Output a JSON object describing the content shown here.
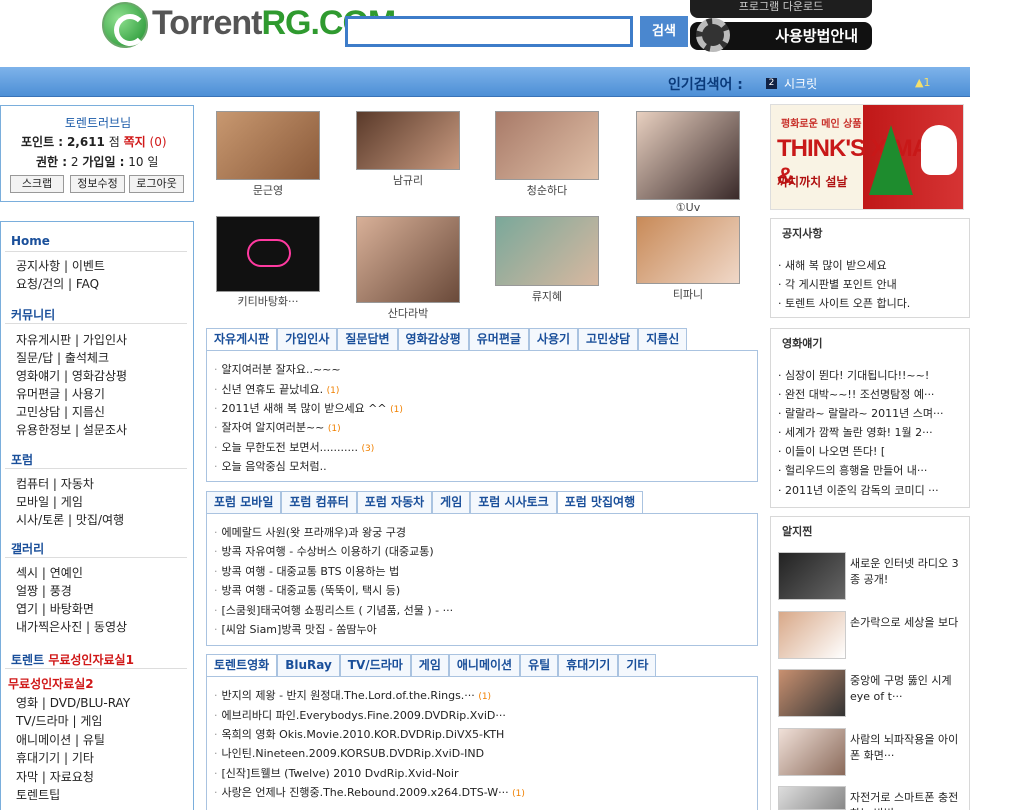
{
  "header": {
    "logo_prefix": "Torrent",
    "logo_suffix": "RG.COM",
    "search_value": "",
    "search_button": "검색",
    "program_download": "프로그램 다운로드",
    "guide": "사용방법안내"
  },
  "popular": {
    "label": "인기검색어 :",
    "rank_number": "2",
    "keyword": "시크릿",
    "rank_change": "▲1"
  },
  "user": {
    "name": "토렌트러브님",
    "points_label": "포인트 :",
    "points": "2,611",
    "points_unit": "점",
    "note_label": "쪽지",
    "note_count": "(0)",
    "rank_label": "권한 :",
    "rank_value": "2",
    "join_label": "가입일 :",
    "join_value": "10 일",
    "scrap": "스크랩",
    "edit": "정보수정",
    "logout": "로그아웃"
  },
  "sidebar": {
    "home": "Home",
    "home_items": [
      "공지사항 | 이벤트",
      "요청/건의 | FAQ"
    ],
    "community": "커뮤니티",
    "community_items": [
      "자유게시판 | 가입인사",
      "질문/답 | 출석체크",
      "영화얘기 | 영화감상평",
      "유머편글 | 사용기",
      "고민상담 | 지름신",
      "유용한정보 | 설문조사"
    ],
    "forum": "포럼",
    "forum_items": [
      "컴퓨터 | 자동차",
      "모바일 | 게임",
      "시사/토론 | 맛집/여행"
    ],
    "gallery": "갤러리",
    "gallery_items": [
      "섹시 | 연예인",
      "얼짱 | 풍경",
      "엽기 | 바탕화면",
      "내가찍은사진 | 동영상"
    ],
    "torrent_prefix": "토렌트",
    "torrent_free": "무료성인자료실1",
    "free2": "무료성인자료실2",
    "torrent_items": [
      "영화 | DVD/BLU-RAY",
      "TV/드라마 | 게임",
      "애니메이션 | 유틸",
      "휴대기기 | 기타",
      "자막 | 자료요청",
      "토렌트팁"
    ]
  },
  "gallery": [
    {
      "caption": "문근영"
    },
    {
      "caption": "남규리"
    },
    {
      "caption": "청순하다"
    },
    {
      "caption": "①Uv"
    },
    {
      "caption": "키티바탕화···"
    },
    {
      "caption": "산다라박"
    },
    {
      "caption": "류지혜"
    },
    {
      "caption": "티파니"
    }
  ],
  "board1": {
    "tabs": [
      "자유게시판",
      "가입인사",
      "질문답변",
      "영화감상평",
      "유머편글",
      "사용기",
      "고민상담",
      "지름신"
    ],
    "items": [
      {
        "title": "알지여러분 잘자요..~~~",
        "count": ""
      },
      {
        "title": "신년 연휴도 끝났네요.",
        "count": "(1)"
      },
      {
        "title": "2011년 새해 복 많이 받으세요 ^^",
        "count": "(1)"
      },
      {
        "title": "잘자여 알지여러분~~",
        "count": "(1)"
      },
      {
        "title": "오늘 무한도전 보면서...........",
        "count": "(3)"
      },
      {
        "title": "오늘 음악중심 모처럼..",
        "count": ""
      }
    ]
  },
  "board2": {
    "tabs": [
      "포럼 모바일",
      "포럼 컴퓨터",
      "포럼 자동차",
      "게임",
      "포럼 시사토크",
      "포럼 맛집여행"
    ],
    "items": [
      {
        "title": "에메랄드 사원(왓 프라깨우)과 왕궁 구경",
        "count": ""
      },
      {
        "title": "방콕 자유여행 - 수상버스 이용하기 (대중교통)",
        "count": ""
      },
      {
        "title": "방콕 여행 - 대중교통 BTS 이용하는 법",
        "count": ""
      },
      {
        "title": "방콕 여행 - 대중교통 (뚝뚝이, 택시 등)",
        "count": ""
      },
      {
        "title": "[스쿰윗]태국여행 쇼핑리스트 ( 기념품, 선물 ) - ···",
        "count": ""
      },
      {
        "title": "[씨암 Siam]방콕 맛집 - 쏨땀누아",
        "count": ""
      }
    ]
  },
  "board3": {
    "tabs": [
      "토렌트영화",
      "BluRay",
      "TV/드라마",
      "게임",
      "애니메이션",
      "유틸",
      "휴대기기",
      "기타"
    ],
    "items": [
      {
        "title": "반지의 제왕 - 반지 원정대.The.Lord.of.the.Rings.···",
        "count": "(1)"
      },
      {
        "title": "에브리바디 파인.Everybodys.Fine.2009.DVDRip.XviD···",
        "count": ""
      },
      {
        "title": "옥희의 영화 Okis.Movie.2010.KOR.DVDRip.DiVX5-KTH",
        "count": ""
      },
      {
        "title": "나인틴.Nineteen.2009.KORSUB.DVDRip.XviD-IND",
        "count": ""
      },
      {
        "title": "[신작]트웰브 (Twelve) 2010 DvdRip.Xvid-Noir",
        "count": ""
      },
      {
        "title": "사랑은 언제나 진행중.The.Rebound.2009.x264.DTS-W···",
        "count": "(1)"
      }
    ]
  },
  "banner": {
    "line1": "평화로운 메인 상품",
    "line2": "THINK'S X-MAS &",
    "line3": "까치까치 설날"
  },
  "notice": {
    "title": "공지사항",
    "items": [
      "새해 복 많이 받으세요",
      "각 게시판별 포인트 안내",
      "토렌트 사이트 오픈 합니다."
    ]
  },
  "movie_talk": {
    "title": "영화얘기",
    "items": [
      "심장이 뛴다! 기대됩니다!!~~!",
      "완전 대박~~!! 조선명탐정 예···",
      "랄랄라~ 랄랄라~ 2011년 스며···",
      "세계가 깜짝 놀란 영화! 1월 2···",
      "이들이 나오면 뜬다! [",
      "헐리우드의 흥행을 만들어 내···",
      "2011년 이준익 감독의 코미디 ···"
    ]
  },
  "alzi": {
    "title": "알지찐",
    "items": [
      "새로운 인터넷 라디오 3종 공개!",
      "손가락으로 세상을 보다",
      "중앙에 구멍 뚫인 시계 eye of t···",
      "사람의 뇌파작용을 아이폰 화면···",
      "자전거로 스마트폰 충전하는 방법"
    ]
  },
  "colors": {
    "accent": "#4a87cf",
    "heading": "#1a4f9a",
    "red": "#d01818",
    "comment": "#f08000"
  }
}
